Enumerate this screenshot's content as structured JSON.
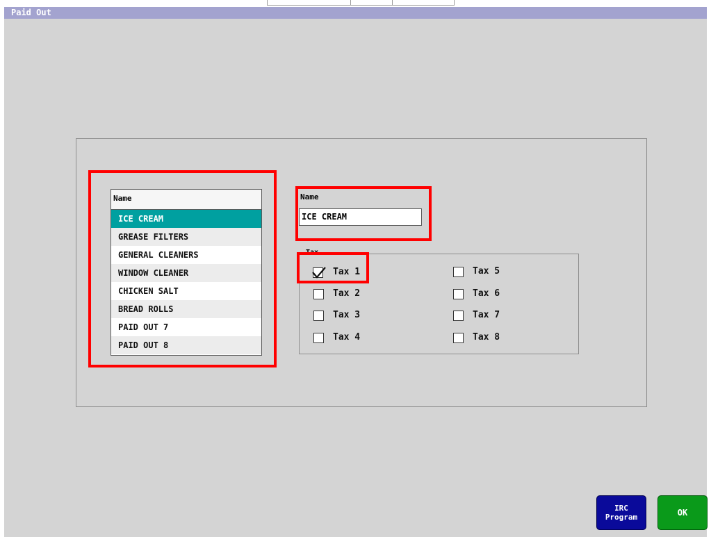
{
  "window": {
    "title": "Paid Out"
  },
  "colors": {
    "titlebar": "#a3a3cf",
    "window_bg": "#d4d4d4",
    "selected_row": "#00a0a0",
    "annotation": "#ff0000",
    "irc_button": "#0a0a9a",
    "ok_button": "#0a9a1a"
  },
  "list": {
    "header": "Name",
    "items": [
      {
        "label": "ICE CREAM",
        "selected": true
      },
      {
        "label": "GREASE FILTERS",
        "selected": false
      },
      {
        "label": "GENERAL CLEANERS",
        "selected": false
      },
      {
        "label": "WINDOW CLEANER",
        "selected": false
      },
      {
        "label": "CHICKEN SALT",
        "selected": false
      },
      {
        "label": "BREAD ROLLS",
        "selected": false
      },
      {
        "label": "PAID OUT 7",
        "selected": false
      },
      {
        "label": "PAID OUT 8",
        "selected": false
      }
    ]
  },
  "name_field": {
    "label": "Name",
    "value": "ICE CREAM"
  },
  "tax": {
    "legend": "Tax",
    "items": [
      {
        "label": "Tax 1",
        "checked": true
      },
      {
        "label": "Tax 2",
        "checked": false
      },
      {
        "label": "Tax 3",
        "checked": false
      },
      {
        "label": "Tax 4",
        "checked": false
      },
      {
        "label": "Tax 5",
        "checked": false
      },
      {
        "label": "Tax 6",
        "checked": false
      },
      {
        "label": "Tax 7",
        "checked": false
      },
      {
        "label": "Tax 8",
        "checked": false
      }
    ]
  },
  "buttons": {
    "irc_line1": "IRC",
    "irc_line2": "Program",
    "ok": "OK"
  }
}
